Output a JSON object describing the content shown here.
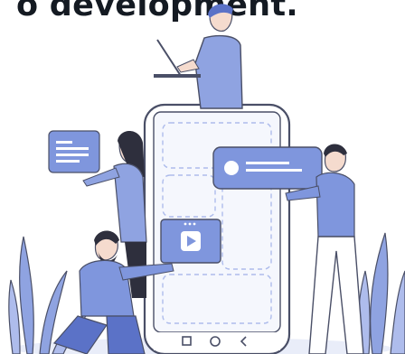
{
  "header": {
    "headline": "o development."
  },
  "colors": {
    "primary": "#7f96dd",
    "primary_dark": "#5b72c7",
    "light": "#dfe5f6",
    "skin": "#f5dbce",
    "dark": "#2e2f3d",
    "outline": "#4a4f67",
    "leaf": "#8fa3e1"
  },
  "icons": {
    "play": "play-triangle-icon",
    "back": "back-chevron-icon",
    "home": "home-circle-icon",
    "recent": "recent-square-icon",
    "menu": "dots-icon"
  }
}
